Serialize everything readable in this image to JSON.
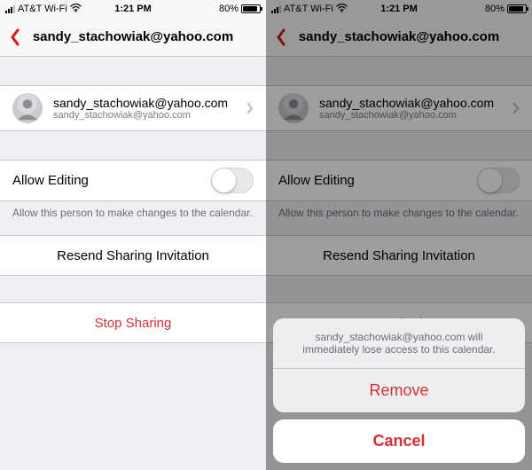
{
  "status": {
    "carrier": "AT&T Wi-Fi",
    "time": "1:21 PM",
    "battery_pct": "80%"
  },
  "nav": {
    "title": "sandy_stachowiak@yahoo.com"
  },
  "user": {
    "display": "sandy_stachowiak@yahoo.com",
    "subtitle": "sandy_stachowiak@yahoo.com"
  },
  "allow_editing": {
    "label": "Allow Editing",
    "footnote": "Allow this person to make changes to the calendar."
  },
  "actions": {
    "resend": "Resend Sharing Invitation",
    "stop_sharing": "Stop Sharing"
  },
  "sheet": {
    "message": "sandy_stachowiak@yahoo.com will immediately lose access to this calendar.",
    "remove": "Remove",
    "cancel": "Cancel"
  }
}
